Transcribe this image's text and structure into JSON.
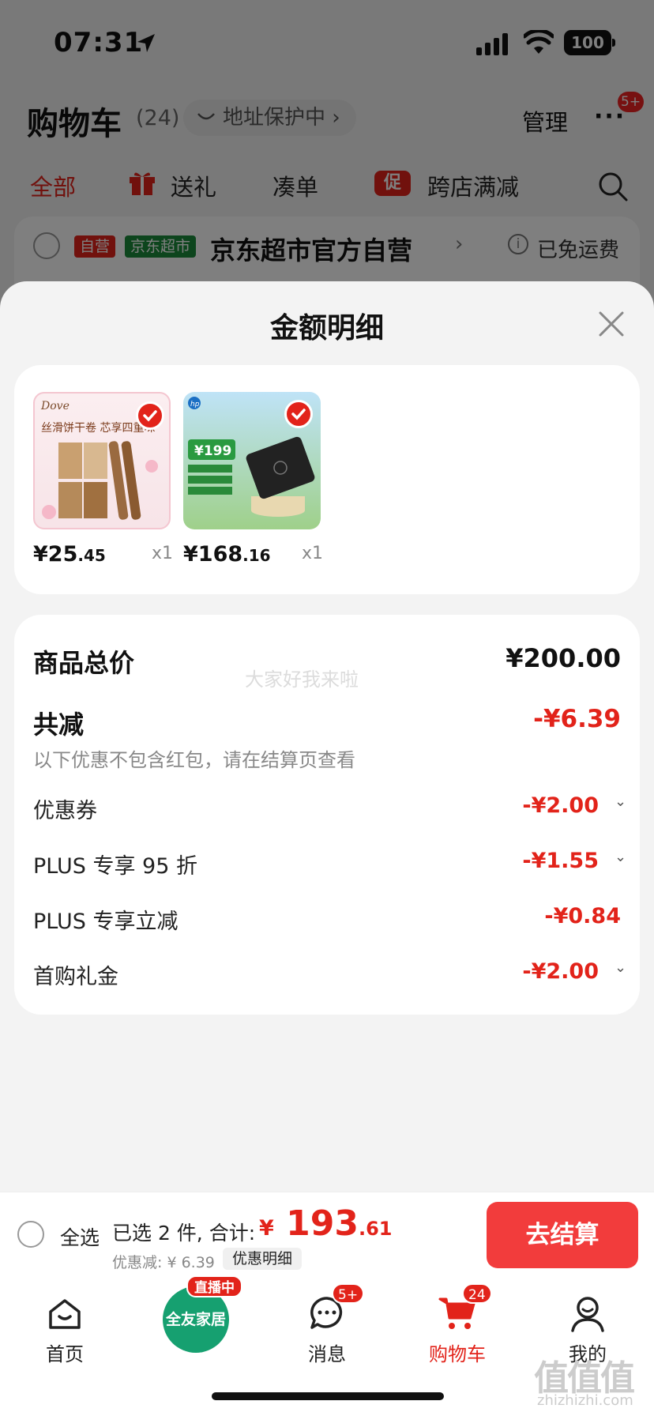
{
  "status_bar": {
    "time": "07:31",
    "battery": "100"
  },
  "cart_header": {
    "title": "购物车",
    "count": "(24)",
    "address_protect": "地址保护中 ›",
    "manage": "管理",
    "more_badge": "5+"
  },
  "filters": {
    "all": "全部",
    "gift": "送礼",
    "combo": "凑单",
    "promo_icon": "促",
    "promo": "跨店满减"
  },
  "store": {
    "tag_self": "自营",
    "tag_jd": "京东超市",
    "name": "京东超市官方自营",
    "chevron": "›",
    "free_shipping": "已免运费"
  },
  "sheet": {
    "title": "金额明细",
    "goods": [
      {
        "price_int": "¥25",
        "price_dec": ".45",
        "qty": "x1",
        "image": "dove-wafer-rolls",
        "image_text": "丝滑饼干卷 芯享四重味",
        "brand": "Dove"
      },
      {
        "price_int": "¥168",
        "price_dec": ".16",
        "qty": "x1",
        "image": "hp-ssd",
        "image_text": "¥199",
        "brand": "hp"
      }
    ],
    "watermark": "大家好我来啦",
    "total_label": "商品总价",
    "total_value": "¥200.00",
    "reduce_label": "共减",
    "reduce_value": "-¥6.39",
    "reduce_note": "以下优惠不包含红包，请在结算页查看",
    "discounts": [
      {
        "label": "优惠券",
        "value": "-¥2.00",
        "chevron": "⌄"
      },
      {
        "label": "PLUS 专享 95 折",
        "value": "-¥1.55",
        "chevron": "⌄"
      },
      {
        "label": "PLUS 专享立减",
        "value": "-¥0.84",
        "chevron": ""
      },
      {
        "label": "首购礼金",
        "value": "-¥2.00",
        "chevron": "⌄"
      }
    ]
  },
  "checkout": {
    "select_all": "全选",
    "selected_text": "已选 2 件, 合计:",
    "total_yen": "¥",
    "total_int": " 193",
    "total_dec": ".61",
    "discount_text": "优惠减: ¥ 6.39",
    "discount_detail": "优惠明细",
    "checkout_button": "去结算"
  },
  "tabs": [
    {
      "label": "首页",
      "icon": "home-icon"
    },
    {
      "label": "全友家居",
      "icon": "live-shop-icon",
      "badge": "直播中"
    },
    {
      "label": "消息",
      "icon": "message-icon",
      "badge": "5+"
    },
    {
      "label": "购物车",
      "icon": "cart-icon",
      "badge": "24"
    },
    {
      "label": "我的",
      "icon": "profile-icon"
    }
  ],
  "watermark_site": {
    "mark": "值值值",
    "url": "zhizhizhi.com"
  },
  "colors": {
    "accent": "#e2231a",
    "checkout": "#f23c3c",
    "live": "#16a070"
  }
}
